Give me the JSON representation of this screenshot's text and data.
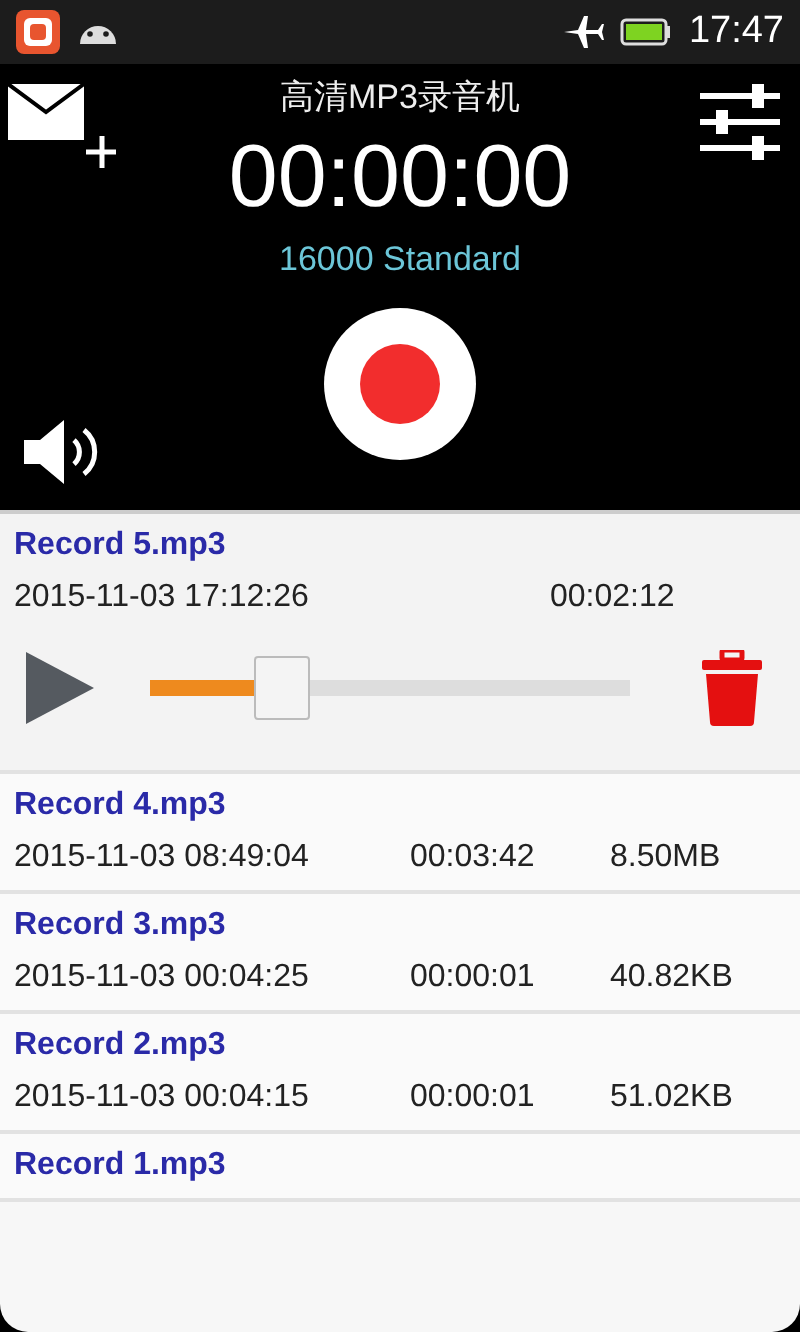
{
  "status_bar": {
    "time": "17:47"
  },
  "header": {
    "title": "高清MP3录音机",
    "timer": "00:00:00",
    "quality": "16000 Standard"
  },
  "records": [
    {
      "name": "Record 5.mp3",
      "date": "2015-11-03 17:12:26",
      "duration": "00:02:12",
      "expanded": true,
      "level": 0.27
    },
    {
      "name": "Record 4.mp3",
      "date": "2015-11-03 08:49:04",
      "duration": "00:03:42",
      "size": "8.50MB",
      "expanded": false
    },
    {
      "name": "Record 3.mp3",
      "date": "2015-11-03 00:04:25",
      "duration": "00:00:01",
      "size": "40.82KB",
      "expanded": false
    },
    {
      "name": "Record 2.mp3",
      "date": "2015-11-03 00:04:15",
      "duration": "00:00:01",
      "size": "51.02KB",
      "expanded": false
    },
    {
      "name": "Record 1.mp3",
      "expanded": false
    }
  ]
}
